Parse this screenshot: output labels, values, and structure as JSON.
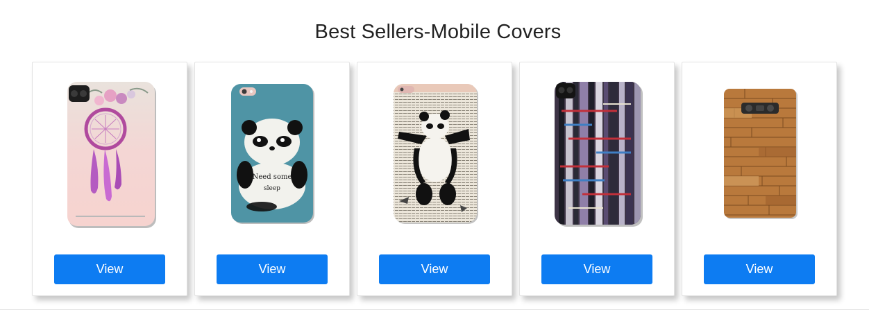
{
  "section": {
    "title": "Best Sellers-Mobile Covers"
  },
  "products": [
    {
      "image": "dreamcatcher-phone-cover",
      "button_label": "View"
    },
    {
      "image": "panda-need-some-sleep-phone-cover",
      "caption_line1": "Need some",
      "caption_line2": "sleep",
      "button_label": "View"
    },
    {
      "image": "banksy-panda-newspaper-phone-cover",
      "button_label": "View"
    },
    {
      "image": "abstract-paint-strokes-phone-cover",
      "button_label": "View"
    },
    {
      "image": "wood-planks-phone-cover",
      "button_label": "View"
    }
  ],
  "colors": {
    "button": "#0d7cf2",
    "button_text": "#ffffff",
    "title": "#222222"
  }
}
